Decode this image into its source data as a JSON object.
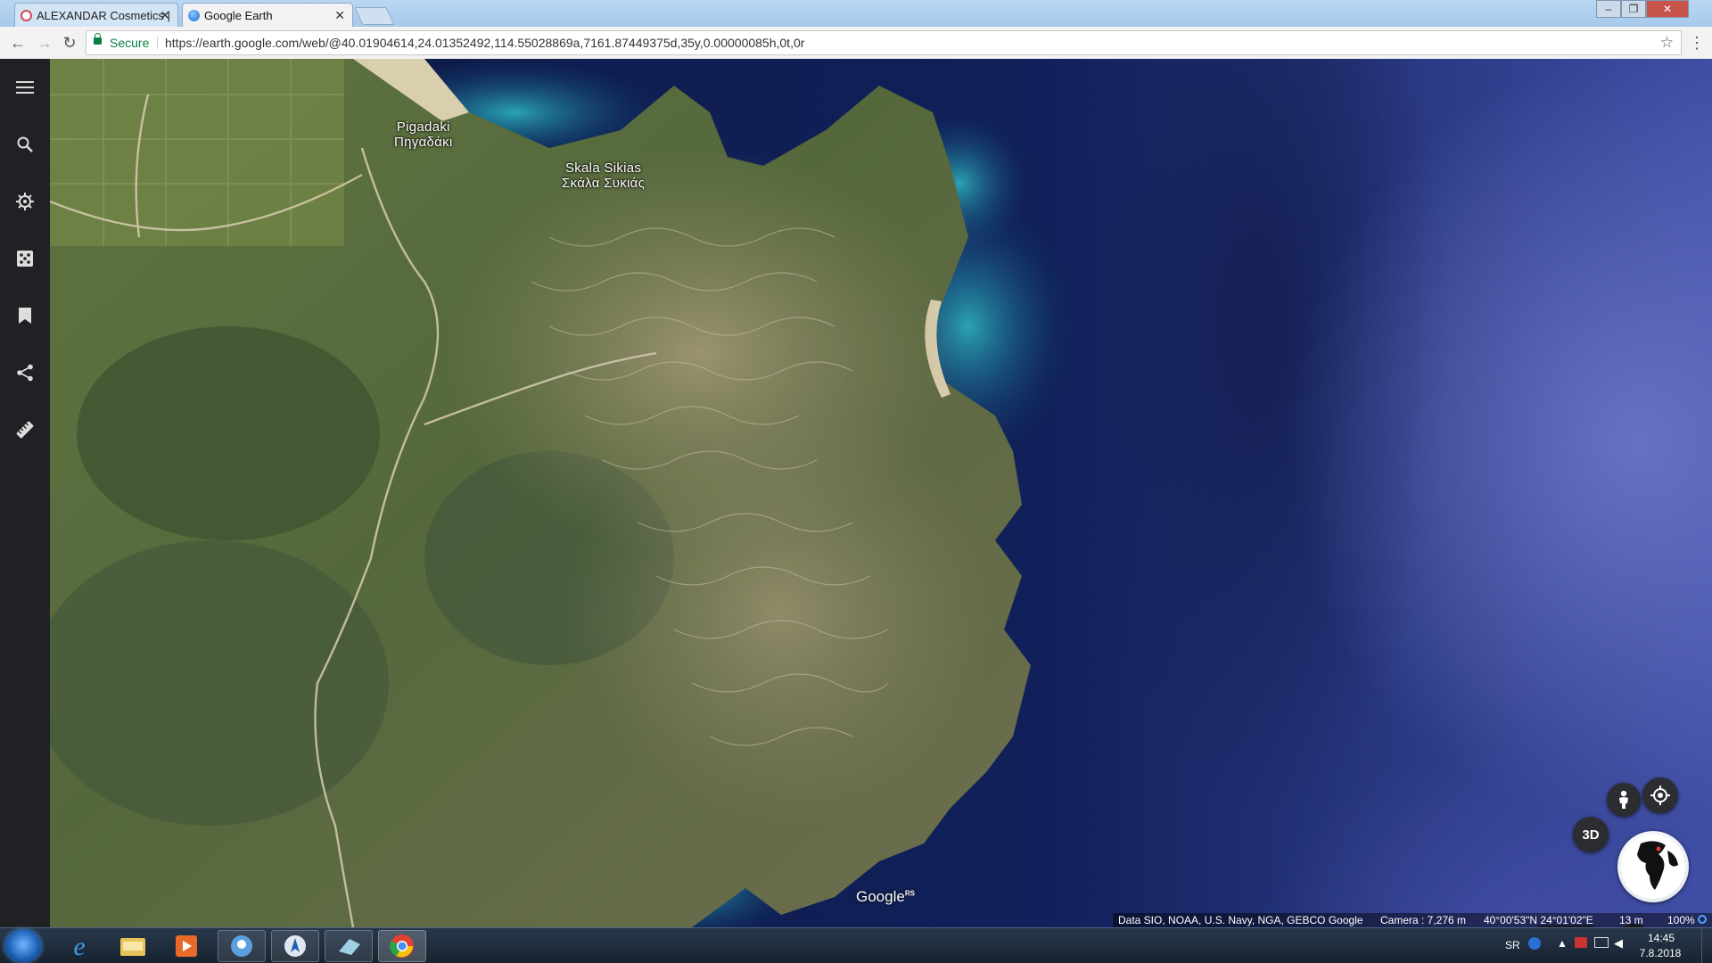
{
  "browser": {
    "tabs": [
      {
        "label": "ALEXANDAR Cosmetics |",
        "close": "✕",
        "active": false
      },
      {
        "label": "Google Earth",
        "close": "✕",
        "active": true
      }
    ],
    "window_controls": {
      "minimize": "–",
      "restore": "❐",
      "close": "✕"
    },
    "nav": {
      "back": "←",
      "forward": "→",
      "reload": "↻"
    },
    "security_label": "Secure",
    "url": "https://earth.google.com/web/@40.01904614,24.01352492,114.55028869a,7161.87449375d,35y,0.00000085h,0t,0r",
    "bookmark_icon": "☆",
    "menu_icon": "⋮"
  },
  "sidebar": {
    "items": [
      {
        "name": "menu-icon"
      },
      {
        "name": "search-icon"
      },
      {
        "name": "voyager-icon"
      },
      {
        "name": "feeling-lucky-icon"
      },
      {
        "name": "projects-icon"
      },
      {
        "name": "share-icon"
      },
      {
        "name": "measure-icon"
      }
    ]
  },
  "map": {
    "place_labels": [
      {
        "latin": "Pigadaki",
        "greek": "Πηγαδάκι"
      },
      {
        "latin": "Skala Sikias",
        "greek": "Σκάλα Συκιάς"
      }
    ],
    "logo": "Google",
    "logo_super": "RS",
    "controls": {
      "three_d": "3D",
      "zoom_out": "−",
      "zoom_in": "+"
    },
    "status": {
      "attribution": "Data SIO, NOAA, U.S. Navy, NGA, GEBCO  Google",
      "camera": "Camera : 7,276 m",
      "coordinates": "40°00'53\"N 24°01'02\"E",
      "elevation": "13 m",
      "zoom": "100%"
    }
  },
  "taskbar": {
    "apps": [
      {
        "name": "internet-explorer-icon",
        "color": "#3a9be6"
      },
      {
        "name": "file-explorer-icon",
        "color": "#e8c35a"
      },
      {
        "name": "media-player-icon",
        "color": "#e86a2a"
      },
      {
        "name": "messenger-icon",
        "color": "#5aa0e0"
      },
      {
        "name": "navigation-app-icon",
        "color": "#e0e6ee"
      },
      {
        "name": "eraser-app-icon",
        "color": "#9fd0e6"
      },
      {
        "name": "chrome-icon",
        "color": "#e34133"
      }
    ],
    "tray": {
      "language": "SR",
      "time": "14:45",
      "date": "7.8.2018"
    }
  }
}
